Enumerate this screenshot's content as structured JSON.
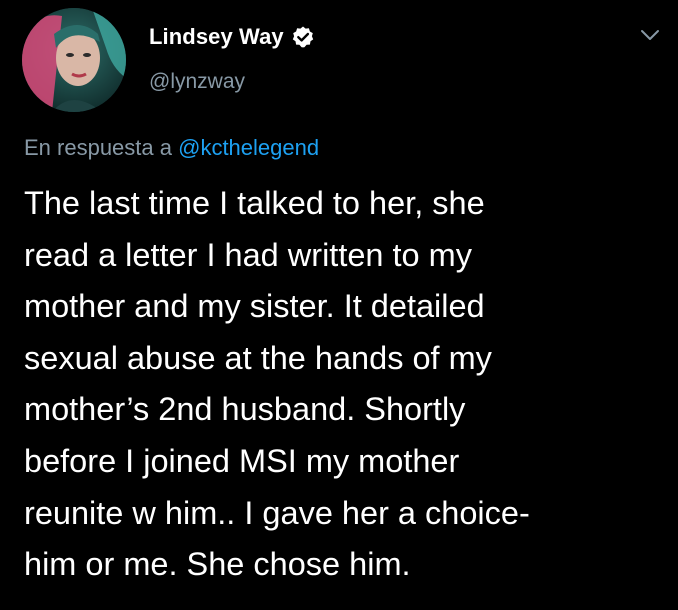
{
  "author": {
    "display_name": "Lindsey Way",
    "handle": "@lynzway",
    "verified": true,
    "verified_badge_icon": "verified-check-icon"
  },
  "reply": {
    "prefix": "En respuesta a",
    "mention": "@kcthelegend"
  },
  "tweet": {
    "lines": [
      "The last time I talked to her, she",
      "read a letter I had written to my",
      "mother and my sister. It detailed",
      "sexual abuse at the hands of my",
      "mother’s 2nd husband. Shortly",
      "before I joined MSI my mother",
      "reunite w him.. I gave her a choice-",
      "him or me. She chose him."
    ]
  },
  "menu": {
    "icon": "chevron-down-icon"
  },
  "colors": {
    "background": "#000000",
    "text": "#ffffff",
    "muted": "#8899a6",
    "link": "#1da1f2"
  }
}
